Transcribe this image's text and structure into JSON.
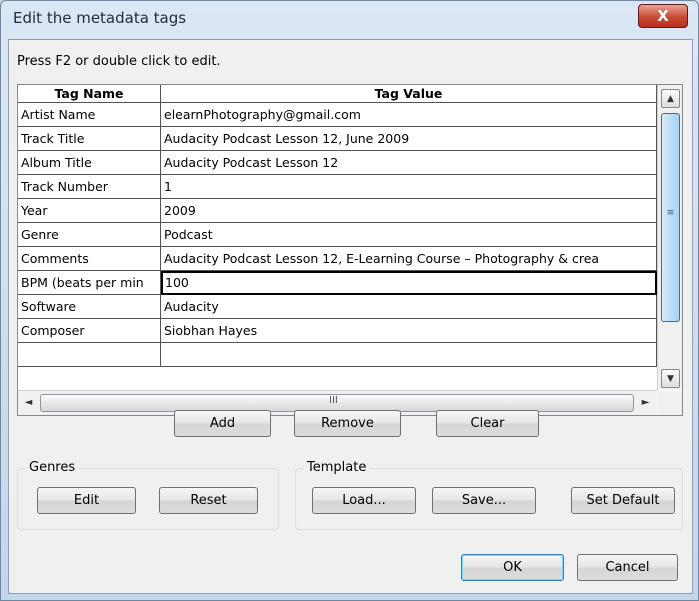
{
  "window": {
    "title": "Edit the metadata tags",
    "close_glyph": "X"
  },
  "hint": "Press F2 or double click to edit.",
  "grid": {
    "headers": {
      "name": "Tag Name",
      "value": "Tag Value"
    },
    "rows": [
      {
        "name": "Artist Name",
        "value": "elearnPhotography@gmail.com"
      },
      {
        "name": "Track Title",
        "value": "Audacity Podcast Lesson 12, June 2009"
      },
      {
        "name": "Album Title",
        "value": "Audacity Podcast Lesson 12"
      },
      {
        "name": "Track Number",
        "value": "1"
      },
      {
        "name": "Year",
        "value": "2009"
      },
      {
        "name": "Genre",
        "value": "Podcast"
      },
      {
        "name": "Comments",
        "value": "Audacity Podcast Lesson 12,  E-Learning Course – Photography & crea"
      },
      {
        "name": "BPM (beats per min",
        "value": "100"
      },
      {
        "name": "Software",
        "value": "Audacity"
      },
      {
        "name": "Composer",
        "value": "Siobhan Hayes"
      },
      {
        "name": "",
        "value": ""
      }
    ],
    "editing_row_index": 7,
    "scroll": {
      "up": "▲",
      "down": "▼",
      "left": "◄",
      "right": "►",
      "vgrip": "≡",
      "hgrip": "III"
    }
  },
  "actions": {
    "add": "Add",
    "remove": "Remove",
    "clear": "Clear"
  },
  "genres": {
    "label": "Genres",
    "edit": "Edit",
    "reset": "Reset"
  },
  "template": {
    "label": "Template",
    "load": "Load...",
    "save": "Save...",
    "set_default": "Set Default"
  },
  "dialog": {
    "ok": "OK",
    "cancel": "Cancel"
  }
}
